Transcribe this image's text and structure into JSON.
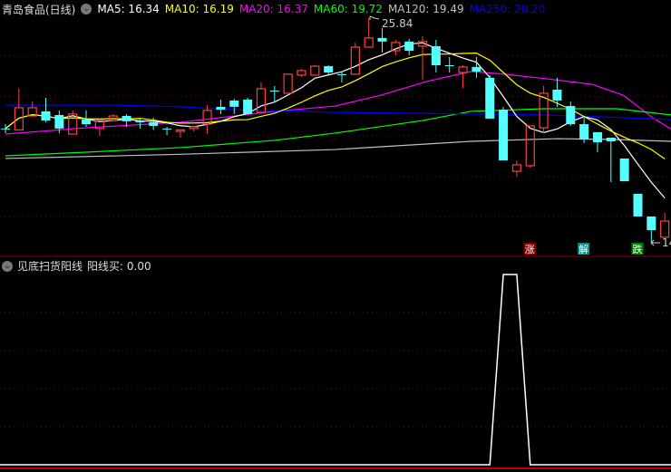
{
  "header": {
    "title": "青岛食品(日线)",
    "ma": [
      {
        "label": "MA5: 16.34",
        "color": "#ffffff"
      },
      {
        "label": "MA10: 16.19",
        "color": "#ffff00"
      },
      {
        "label": "MA20: 16.37",
        "color": "#ff00ff"
      },
      {
        "label": "MA60: 19.72",
        "color": "#00ff00"
      },
      {
        "label": "MA120: 19.49",
        "color": "#c0c0c0"
      },
      {
        "label": "MA250: 20.20",
        "color": "#0000ff"
      }
    ]
  },
  "indicator": {
    "title": "见底扫货阳线",
    "value_label": "阳线买: 0.00"
  },
  "annotations": {
    "high_label": "25.84",
    "low_label": "14"
  },
  "markers": [
    {
      "index": 39,
      "text": "涨",
      "color": "#8b0000"
    },
    {
      "index": 43,
      "text": "解",
      "color": "#008b8b"
    },
    {
      "index": 47,
      "text": "跌",
      "color": "#008000"
    }
  ],
  "colors": {
    "up": "#ff4040",
    "down": "#54ffff",
    "grid": "#8b0000"
  },
  "chart_data": {
    "type": "candlestick",
    "ylim": [
      13.5,
      26.3
    ],
    "candles": [
      [
        20.05,
        20.05,
        20.28,
        19.81
      ],
      [
        19.98,
        21.14,
        22.14,
        19.98
      ],
      [
        20.71,
        21.14,
        21.47,
        20.71
      ],
      [
        20.95,
        20.47,
        21.66,
        20.38
      ],
      [
        20.76,
        20.05,
        21.0,
        19.81
      ],
      [
        19.76,
        20.81,
        21.0,
        19.76
      ],
      [
        20.52,
        20.28,
        21.0,
        20.14
      ],
      [
        20.05,
        20.47,
        20.47,
        19.67
      ],
      [
        20.47,
        20.71,
        20.81,
        20.47
      ],
      [
        20.71,
        20.43,
        20.81,
        20.14
      ],
      [
        20.47,
        20.38,
        20.57,
        20.05
      ],
      [
        20.38,
        20.19,
        20.62,
        19.98
      ],
      [
        20.05,
        20.02,
        20.14,
        19.71
      ],
      [
        19.9,
        19.98,
        19.98,
        19.57
      ],
      [
        20.05,
        20.14,
        20.19,
        19.9
      ],
      [
        20.28,
        21.0,
        21.28,
        19.76
      ],
      [
        21.19,
        21.04,
        21.57,
        20.81
      ],
      [
        21.52,
        21.19,
        21.61,
        20.81
      ],
      [
        21.57,
        20.81,
        21.66,
        20.81
      ],
      [
        20.9,
        22.14,
        22.47,
        20.9
      ],
      [
        22.04,
        22.0,
        22.28,
        21.42
      ],
      [
        21.9,
        22.9,
        22.9,
        21.9
      ],
      [
        22.85,
        23.09,
        23.18,
        22.75
      ],
      [
        22.85,
        23.32,
        23.37,
        22.85
      ],
      [
        23.32,
        22.99,
        23.37,
        22.9
      ],
      [
        22.9,
        22.85,
        22.99,
        22.47
      ],
      [
        22.9,
        24.32,
        24.56,
        22.9
      ],
      [
        24.32,
        24.8,
        25.84,
        24.32
      ],
      [
        24.8,
        24.61,
        25.32,
        24.04
      ],
      [
        24.13,
        24.56,
        24.7,
        23.89
      ],
      [
        24.61,
        24.13,
        24.75,
        23.89
      ],
      [
        24.37,
        24.61,
        24.89,
        22.61
      ],
      [
        24.37,
        23.37,
        24.7,
        22.99
      ],
      [
        23.37,
        23.35,
        23.8,
        22.99
      ],
      [
        22.99,
        23.28,
        23.37,
        22.18
      ],
      [
        23.28,
        23.04,
        23.8,
        22.71
      ],
      [
        22.71,
        20.57,
        22.85,
        20.57
      ],
      [
        21.04,
        18.38,
        21.19,
        18.38
      ],
      [
        17.81,
        18.15,
        18.38,
        17.53
      ],
      [
        18.1,
        20.19,
        20.19,
        18.0
      ],
      [
        20.09,
        21.9,
        22.28,
        19.81
      ],
      [
        22.09,
        21.52,
        22.71,
        21.19
      ],
      [
        21.23,
        20.28,
        21.47,
        20.19
      ],
      [
        20.28,
        19.48,
        20.62,
        19.29
      ],
      [
        19.86,
        19.33,
        19.86,
        18.81
      ],
      [
        19.57,
        19.38,
        19.57,
        17.24
      ],
      [
        18.48,
        17.29,
        18.48,
        17.29
      ],
      [
        16.63,
        15.44,
        16.63,
        15.44
      ],
      [
        15.44,
        14.72,
        15.44,
        14.06
      ],
      [
        14.35,
        15.2,
        15.63,
        14.35
      ]
    ],
    "candle_fields": [
      "open",
      "close",
      "high",
      "low"
    ],
    "ma_lines": [
      {
        "name": "MA20",
        "color": "#ff00ff",
        "points": [
          [
            0,
            19.76
          ],
          [
            6,
            20.09
          ],
          [
            13,
            20.38
          ],
          [
            20,
            20.95
          ],
          [
            24.5,
            21.23
          ],
          [
            27.9,
            21.8
          ],
          [
            31.3,
            22.52
          ],
          [
            34.6,
            23.04
          ],
          [
            37.1,
            22.9
          ],
          [
            40.2,
            22.66
          ],
          [
            43.6,
            22.37
          ],
          [
            45.9,
            21.8
          ],
          [
            48.1,
            20.62
          ],
          [
            49.5,
            20.0
          ]
        ]
      },
      {
        "name": "MA60",
        "color": "#00ff00",
        "points": [
          [
            0,
            18.62
          ],
          [
            6,
            18.81
          ],
          [
            13,
            19.05
          ],
          [
            20,
            19.43
          ],
          [
            24.5,
            19.81
          ],
          [
            31,
            20.47
          ],
          [
            34.6,
            20.95
          ],
          [
            40,
            21.09
          ],
          [
            45.4,
            21.09
          ],
          [
            49.5,
            20.76
          ]
        ]
      },
      {
        "name": "MA120",
        "color": "#c0c0c0",
        "points": [
          [
            0,
            18.48
          ],
          [
            13,
            18.7
          ],
          [
            24.5,
            18.95
          ],
          [
            34.6,
            19.38
          ],
          [
            41,
            19.52
          ],
          [
            45,
            19.48
          ],
          [
            49.5,
            19.38
          ]
        ]
      },
      {
        "name": "MA250",
        "color": "#0000ff",
        "points": [
          [
            0,
            21.28
          ],
          [
            8,
            21.28
          ],
          [
            13,
            21.19
          ],
          [
            17,
            21.04
          ],
          [
            24.5,
            20.9
          ],
          [
            34.6,
            20.81
          ],
          [
            40,
            20.76
          ],
          [
            46,
            20.62
          ],
          [
            49.5,
            20.52
          ]
        ]
      }
    ],
    "computed_ma": [
      {
        "name": "MA5",
        "period": 5,
        "color": "#ffffff"
      },
      {
        "name": "MA10",
        "period": 10,
        "color": "#ffff00"
      }
    ],
    "indicator_series": {
      "name": "阳线买",
      "values": [
        0,
        0,
        0,
        0,
        0,
        0,
        0,
        0,
        0,
        0,
        0,
        0,
        0,
        0,
        0,
        0,
        0,
        0,
        0,
        0,
        0,
        0,
        0,
        0,
        0,
        0,
        0,
        0,
        0,
        0,
        0,
        0,
        0,
        0,
        0,
        0,
        0,
        1,
        1,
        0,
        0,
        0,
        0,
        0,
        0,
        0,
        0,
        0,
        0,
        0
      ],
      "ylim": [
        0,
        1
      ]
    }
  }
}
